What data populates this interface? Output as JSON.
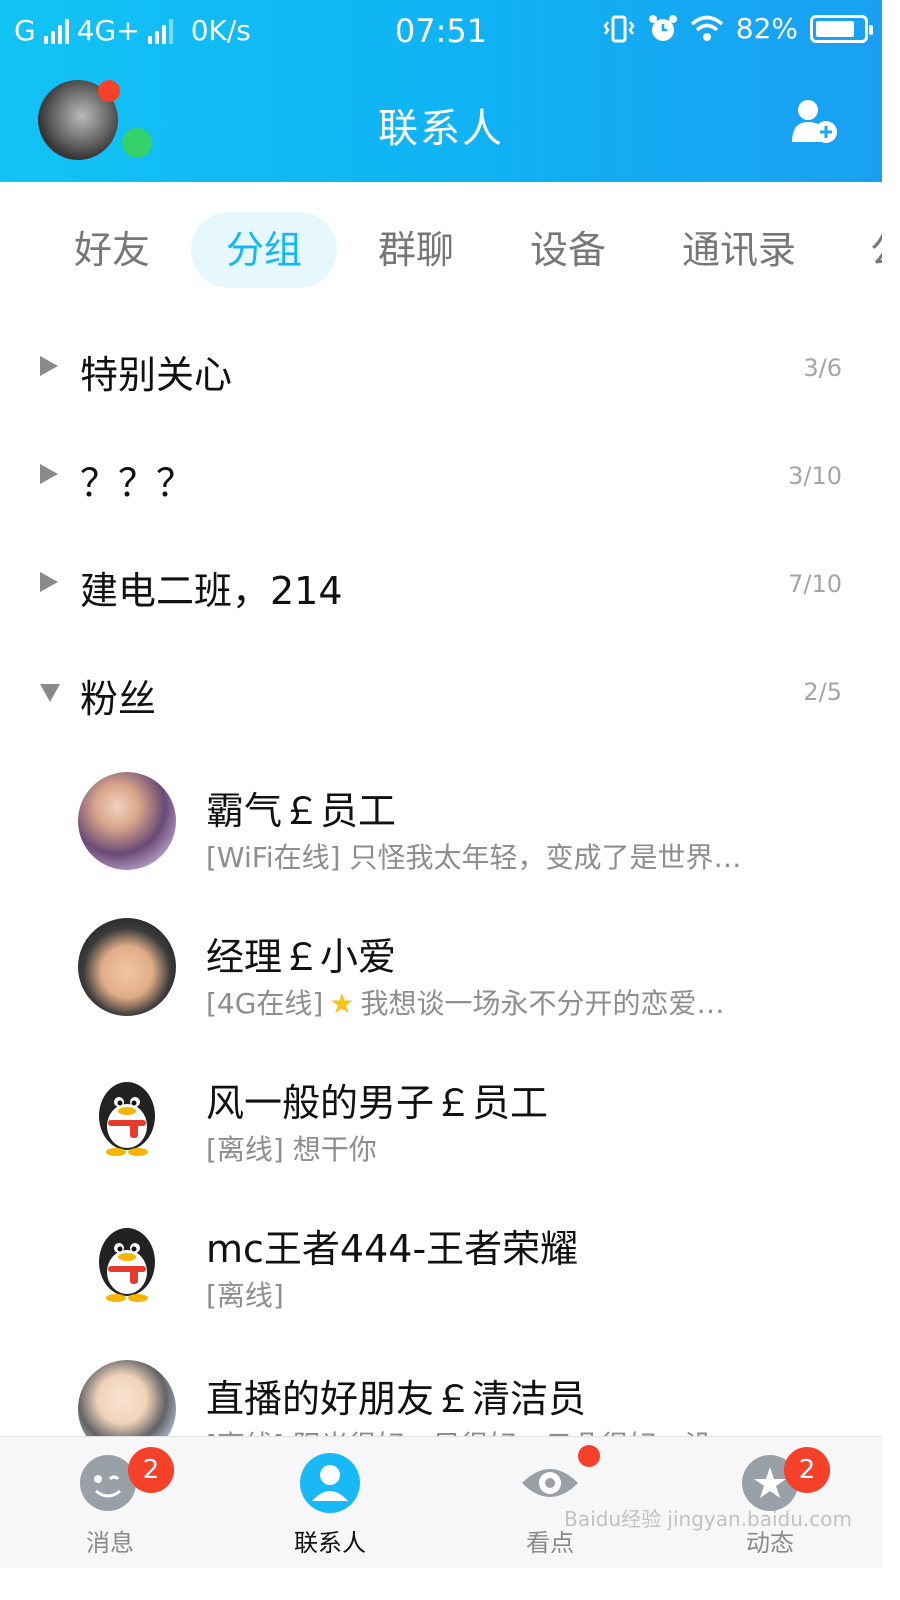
{
  "status_bar": {
    "carrier": "G",
    "network": "4G+",
    "speed": "0K/s",
    "time": "07:51",
    "battery": "82%",
    "battery_level": 0.82
  },
  "header": {
    "title": "联系人"
  },
  "tabs": [
    {
      "label": "好友",
      "active": false
    },
    {
      "label": "分组",
      "active": true
    },
    {
      "label": "群聊",
      "active": false
    },
    {
      "label": "设备",
      "active": false
    },
    {
      "label": "通讯录",
      "active": false
    },
    {
      "label": "公",
      "active": false
    }
  ],
  "groups": [
    {
      "name": "特别关心",
      "count": "3/6",
      "expanded": false
    },
    {
      "name": "？？？",
      "count": "3/10",
      "expanded": false
    },
    {
      "name": "建电二班，214",
      "count": "7/10",
      "expanded": false
    },
    {
      "name": "粉丝",
      "count": "2/5",
      "expanded": true
    }
  ],
  "contacts": [
    {
      "name": "霸气￡员工",
      "status": "[WiFi在线]",
      "signature": "只怪我太年轻，变成了是世界…",
      "avatar": "photo"
    },
    {
      "name": "经理￡小爱",
      "status": "[4G在线]",
      "signature": "我想谈一场永不分开的恋爱…",
      "avatar": "photo",
      "vip_icon": "star-icon"
    },
    {
      "name": "风一般的男子￡员工",
      "status": "[离线]",
      "signature": "想干你",
      "avatar": "penguin-icon"
    },
    {
      "name": "mc王者444-王者荣耀",
      "status": "[离线]",
      "signature": "",
      "avatar": "penguin-icon"
    },
    {
      "name": "直播的好朋友￡清洁员",
      "status": "[离线]",
      "signature": "阳光很好，风很好，云朵很好，没",
      "avatar": "photo"
    }
  ],
  "bottom_nav": [
    {
      "label": "消息",
      "icon": "chat-face-icon",
      "badge": "2",
      "active": false
    },
    {
      "label": "联系人",
      "icon": "contacts-icon",
      "badge": "",
      "active": true
    },
    {
      "label": "看点",
      "icon": "eye-icon",
      "dot": true,
      "active": false
    },
    {
      "label": "动态",
      "icon": "star-planet-icon",
      "badge": "2",
      "active": false
    }
  ],
  "watermark": "Baidu经验 jingyan.baidu.com",
  "colors": {
    "header_bg": "#12b9f5",
    "tab_active": "#13b7f5",
    "tab_active_bg": "#e6f7fd",
    "badge": "#f5402a",
    "online": "#35d26b"
  }
}
